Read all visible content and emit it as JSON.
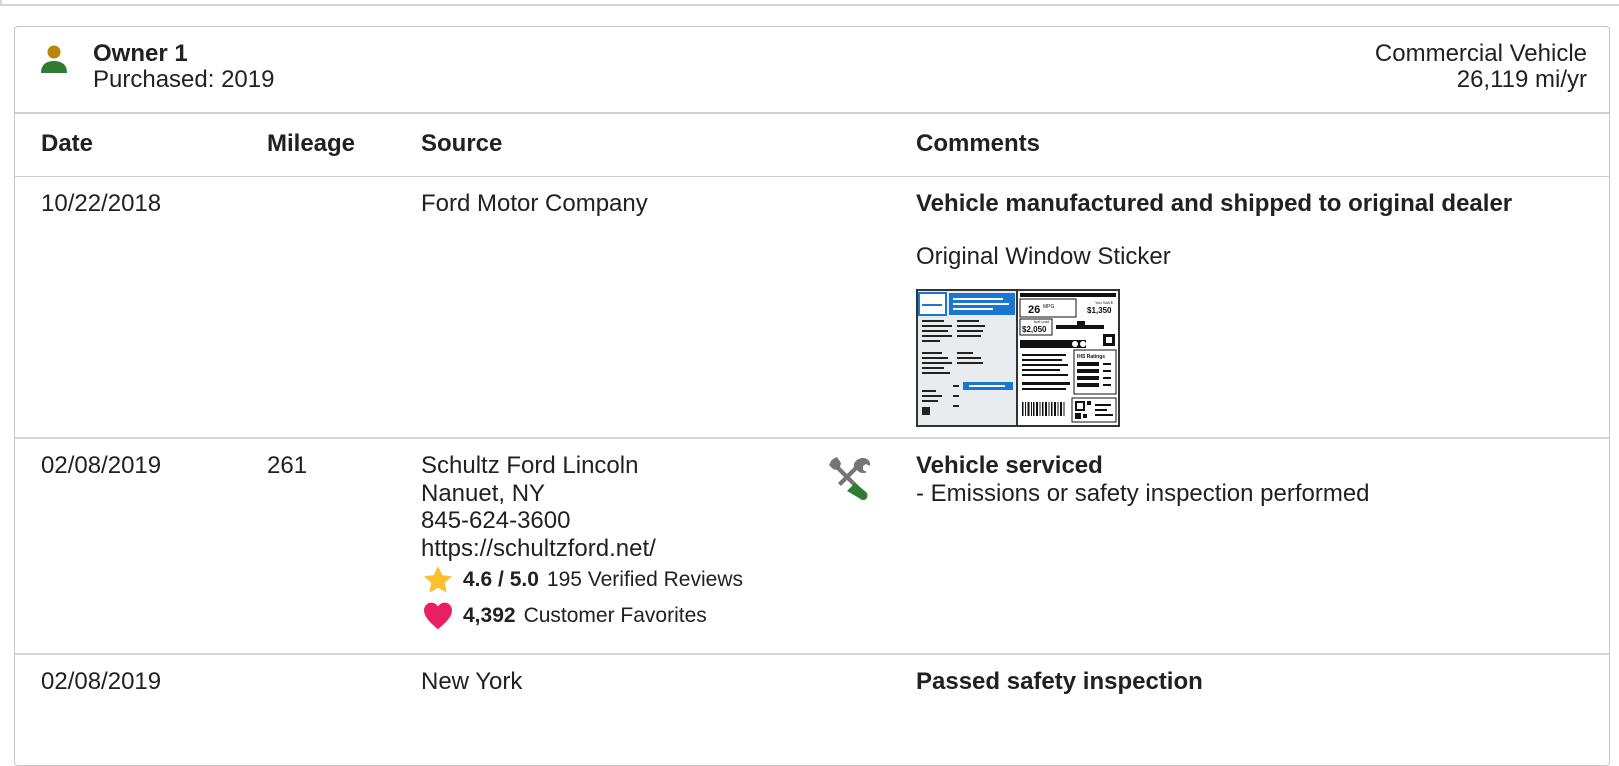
{
  "owner": {
    "name": "Owner 1",
    "purchased": "Purchased: 2019",
    "vehicle_type": "Commercial Vehicle",
    "mileage_rate": "26,119 mi/yr",
    "icon": "person-icon",
    "icon_color": "#2e7d32",
    "icon_head_color": "#b8860b"
  },
  "table": {
    "headers": {
      "date": "Date",
      "mileage": "Mileage",
      "source": "Source",
      "comments": "Comments"
    },
    "rows": [
      {
        "date": "10/22/2018",
        "mileage": "",
        "source": "Ford Motor Company",
        "comment_title": "Vehicle manufactured and shipped to original dealer",
        "comment_sub": "Original Window Sticker",
        "sticker": {
          "mpg": "26",
          "mpg_unit": "MPG",
          "save": "$1,350",
          "cost": "$2,050",
          "ratings_label": "IHS Ratings",
          "save_label": "You SAVE",
          "cost_label": "fuel cost"
        }
      },
      {
        "date": "02/08/2019",
        "mileage": "261",
        "source_name": "Schultz Ford Lincoln",
        "source_location": "Nanuet, NY",
        "source_phone": "845-624-3600",
        "source_url": "https://schultzford.net/",
        "rating": "4.6 / 5.0",
        "reviews": "195 Verified Reviews",
        "favorites_count": "4,392",
        "favorites_label": "Customer Favorites",
        "comment_title": "Vehicle serviced",
        "comment_detail": "- Emissions or safety inspection performed",
        "icon": "wrench-screwdriver-icon"
      },
      {
        "date": "02/08/2019",
        "mileage": "",
        "source": "New York",
        "comment_title": "Passed safety inspection"
      }
    ]
  },
  "colors": {
    "star": "#fbc02d",
    "heart": "#e91e63",
    "tool_green": "#2e7d32",
    "tool_gray": "#757575",
    "sticker_blue": "#1976d2"
  }
}
